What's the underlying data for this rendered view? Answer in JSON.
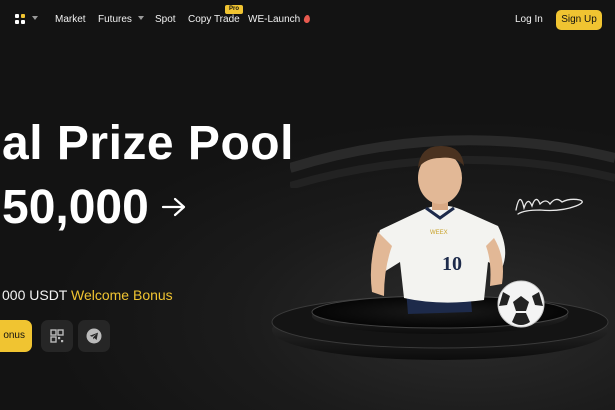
{
  "header": {
    "logo_icon": "grid-logo-icon",
    "nav": [
      {
        "label": "Market"
      },
      {
        "label": "Futures",
        "has_dropdown": true
      },
      {
        "label": "Spot"
      },
      {
        "label": "Copy Trade",
        "badge": "Pro"
      },
      {
        "label": "WE-Launch",
        "icon": "fire-icon"
      }
    ],
    "login_label": "Log In",
    "signup_label": "Sign Up"
  },
  "hero": {
    "title_line1": "al Prize Pool",
    "title_line2": "50,000",
    "arrow_icon": "arrow-right-icon",
    "bonus_amount": "000 USDT",
    "bonus_label": "Welcome Bonus",
    "cta_label": "onus",
    "qr_icon": "qr-code-icon",
    "telegram_icon": "telegram-icon"
  },
  "illustration": {
    "jersey_number": "10",
    "jersey_brand": "WEEX"
  },
  "colors": {
    "accent": "#f0c431",
    "background": "#151515",
    "button_dark": "#262626",
    "fire": "#e85a4f"
  }
}
